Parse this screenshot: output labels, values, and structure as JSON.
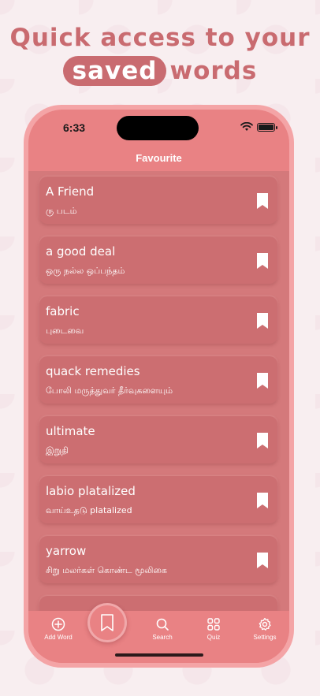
{
  "headline": {
    "line1": "Quick access to your",
    "highlight": "saved",
    "rest": "words"
  },
  "status": {
    "time": "6:33"
  },
  "nav": {
    "title": "Favourite"
  },
  "words": [
    {
      "word": "A Friend",
      "meaning": "ரு படம்"
    },
    {
      "word": "a good deal",
      "meaning": "ஒரு நல்ல ஒப்பந்தம்"
    },
    {
      "word": "fabric",
      "meaning": "புடைவை"
    },
    {
      "word": "quack remedies",
      "meaning": "போலி மருத்துவர் தீர்வுகளையும்"
    },
    {
      "word": "ultimate",
      "meaning": "இறுதி"
    },
    {
      "word": "labio platalized",
      "meaning": "வாய்உதடு platalized"
    },
    {
      "word": "yarrow",
      "meaning": "சிறு மலர்கள் கொண்ட மூலிகை"
    }
  ],
  "tabs": {
    "add_word": "Add Word",
    "search": "Search",
    "quiz": "Quiz",
    "settings": "Settings"
  },
  "colors": {
    "accent": "#c96b70",
    "screen": "#e98284",
    "card": "#cc6e71",
    "frame": "#f4a4a6"
  },
  "icons": {
    "bookmark": "bookmark-icon",
    "add": "plus-circle-icon",
    "search": "search-icon",
    "quiz": "grid-icon",
    "settings": "gear-icon"
  }
}
